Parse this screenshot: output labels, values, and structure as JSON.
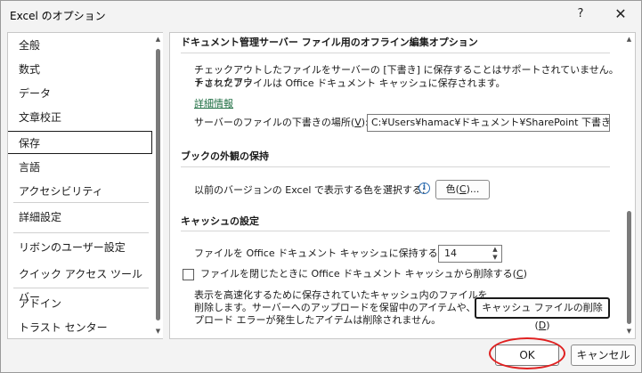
{
  "window": {
    "title": "Excel のオプション",
    "help": "?",
    "close": "✕"
  },
  "sidebar": {
    "items": [
      {
        "label": "全般"
      },
      {
        "label": "数式"
      },
      {
        "label": "データ"
      },
      {
        "label": "文章校正"
      },
      {
        "label": "保存",
        "selected": true
      },
      {
        "label": "言語"
      },
      {
        "label": "アクセシビリティ"
      },
      {
        "label": "詳細設定"
      },
      {
        "label": "リボンのユーザー設定"
      },
      {
        "label": "クイック アクセス ツール バー"
      },
      {
        "label": "アドイン"
      },
      {
        "label": "トラスト センター"
      }
    ]
  },
  "content": {
    "offline": {
      "heading": "ドキュメント管理サーバー ファイル用のオフライン編集オプション",
      "desc_line1": "チェックアウトしたファイルをサーバーの [下書き] に保存することはサポートされていません。チェックアウ",
      "desc_line2": "トされたファイルは Office ドキュメント キャッシュに保存されます。",
      "more_info": "詳細情報",
      "location_label": "サーバーのファイルの下書きの場所(",
      "location_key": "V",
      "location_label_end": "):",
      "location_value": "C:¥Users¥hamac¥ドキュメント¥SharePoint 下書き¥"
    },
    "appearance": {
      "heading": "ブックの外観の保持",
      "color_label": "以前のバージョンの Excel で表示する色を選択する:",
      "info_icon": "i",
      "color_button_pre": "色(",
      "color_button_key": "C",
      "color_button_post": ")..."
    },
    "cache": {
      "heading": "キャッシュの設定",
      "days_label": "ファイルを Office ドキュメント キャッシュに保持する日数:",
      "days_value": "14",
      "delete_on_close_pre": "ファイルを閉じたときに Office ドキュメント キャッシュから削除する(",
      "delete_on_close_key": "C",
      "delete_on_close_post": ")",
      "delete_on_close_checked": false,
      "explain_line1": "表示を高速化するために保存されていたキャッシュ内のファイルを",
      "explain_line2": "削除します。サーバーへのアップロードを保留中のアイテムや、アッ",
      "explain_line3": "プロード エラーが発生したアイテムは削除されません。",
      "delete_button_pre": "キャッシュ ファイルの削除(",
      "delete_button_key": "D",
      "delete_button_post": ")"
    }
  },
  "footer": {
    "ok": "OK",
    "cancel": "キャンセル"
  },
  "colors": {
    "link": "#1f6e43",
    "highlight": "#e02020",
    "info": "#2b6cb0"
  }
}
